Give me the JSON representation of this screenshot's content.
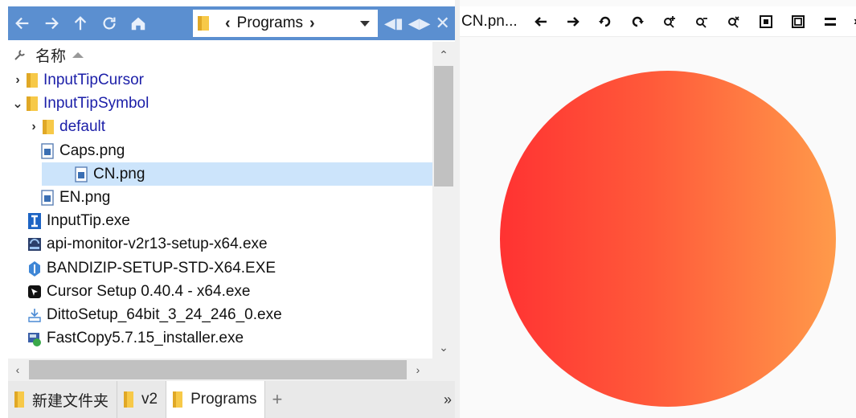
{
  "toolbar": {
    "path_label": "Programs",
    "back_icon": "arrow-left-icon",
    "forward_icon": "arrow-right-icon",
    "up_icon": "arrow-up-icon",
    "refresh_icon": "refresh-icon",
    "home_icon": "home-icon"
  },
  "header": {
    "name_label": "名称"
  },
  "tree": [
    {
      "label": "InputTipCursor",
      "type": "folder",
      "expander": "›",
      "indent": 0
    },
    {
      "label": "InputTipSymbol",
      "type": "folder",
      "expander": "⌄",
      "indent": 0
    },
    {
      "label": "default",
      "type": "folder",
      "expander": "›",
      "indent": 1
    },
    {
      "label": "Caps.png",
      "type": "png",
      "expander": "",
      "indent": 1
    },
    {
      "label": "CN.png",
      "type": "png",
      "expander": "",
      "indent": 1,
      "selected": true
    },
    {
      "label": "EN.png",
      "type": "png",
      "expander": "",
      "indent": 1
    },
    {
      "label": "InputTip.exe",
      "type": "exe-i",
      "expander": "",
      "indent": 0
    },
    {
      "label": "api-monitor-v2r13-setup-x64.exe",
      "type": "exe-api",
      "expander": "",
      "indent": 0
    },
    {
      "label": "BANDIZIP-SETUP-STD-X64.EXE",
      "type": "exe-bz",
      "expander": "",
      "indent": 0
    },
    {
      "label": "Cursor Setup 0.40.4 - x64.exe",
      "type": "exe-cursor",
      "expander": "",
      "indent": 0
    },
    {
      "label": "DittoSetup_64bit_3_24_246_0.exe",
      "type": "exe-ditto",
      "expander": "",
      "indent": 0
    },
    {
      "label": "FastCopy5.7.15_installer.exe",
      "type": "exe-fc",
      "expander": "",
      "indent": 0
    }
  ],
  "tabs": [
    {
      "label": "新建文件夹",
      "active": false
    },
    {
      "label": "v2",
      "active": false
    },
    {
      "label": "Programs",
      "active": true
    }
  ],
  "tabs_more": "»",
  "tabs_plus": "+",
  "preview": {
    "title": "CN.pn...",
    "gradient": [
      "#ff3232",
      "#ff9a4a"
    ]
  },
  "colors": {
    "toolbar": "#5b8fd0",
    "selection": "#cce4fb",
    "folder_text": "#1b1ea8"
  }
}
